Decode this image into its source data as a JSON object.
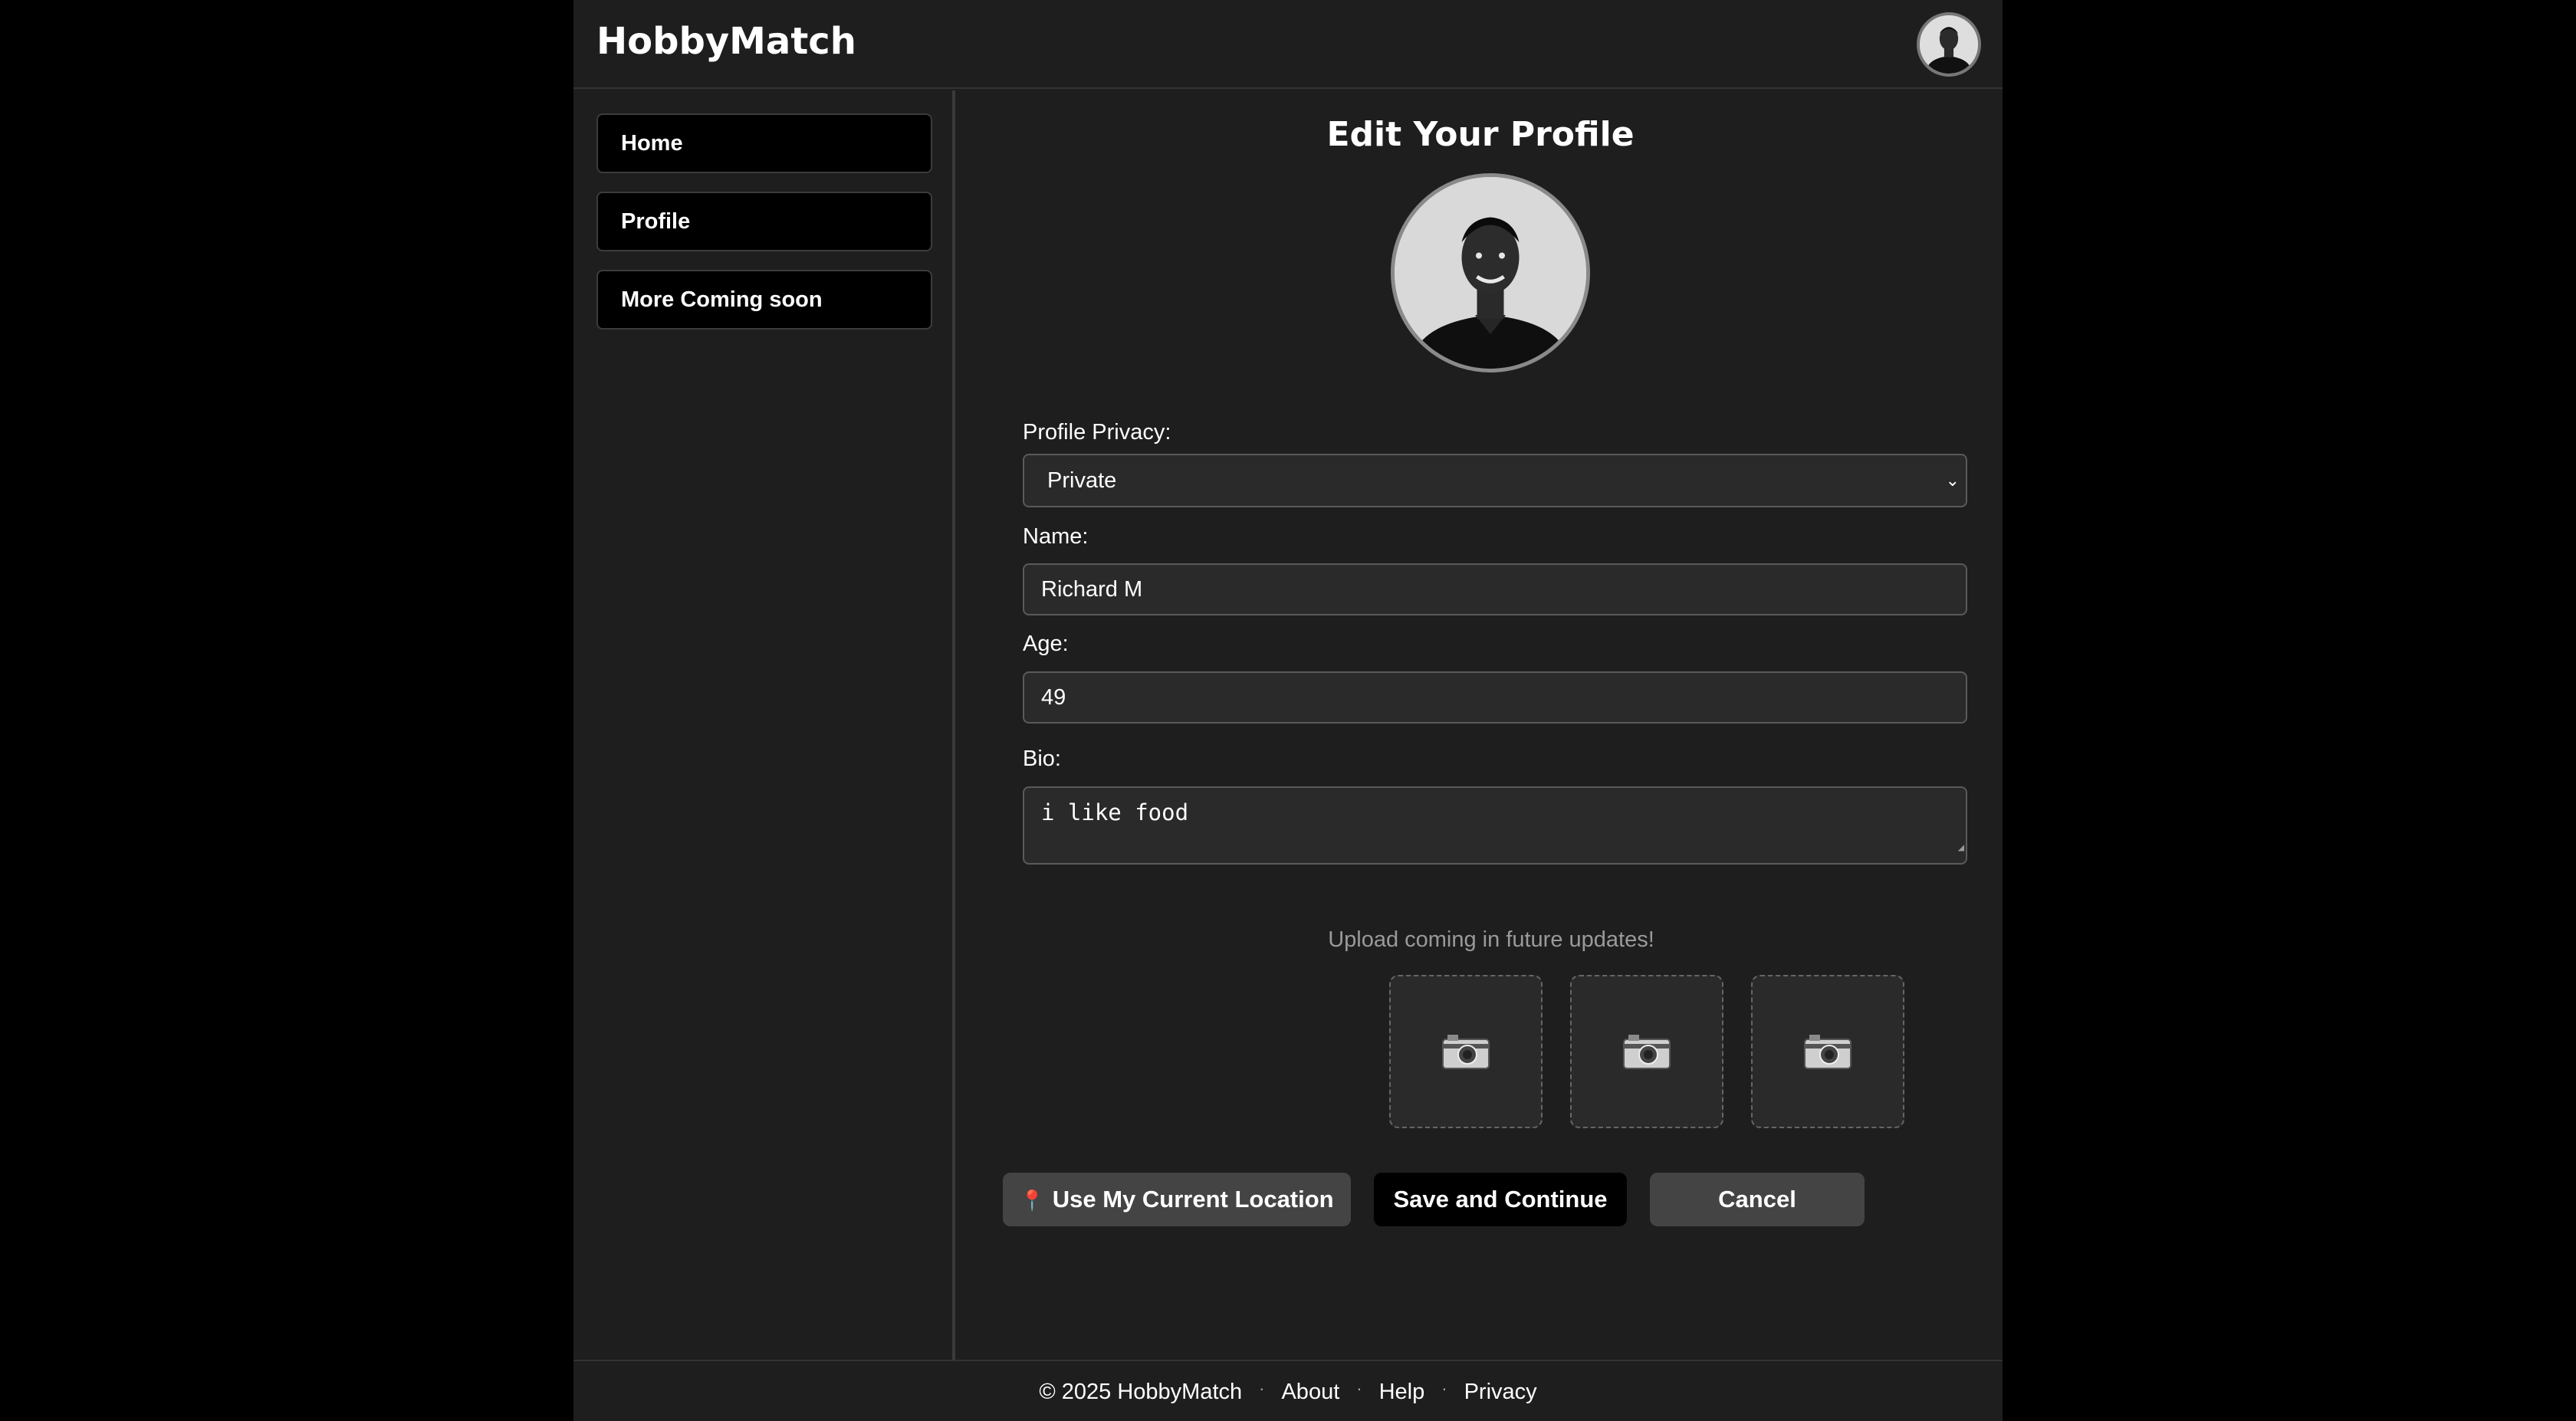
{
  "app": {
    "brand": "HobbyMatch"
  },
  "sidebar": {
    "items": [
      {
        "label": "Home"
      },
      {
        "label": "Profile"
      },
      {
        "label": "More Coming soon"
      }
    ]
  },
  "main": {
    "title": "Edit Your Profile",
    "privacy": {
      "label": "Profile Privacy:",
      "value": "Private"
    },
    "name": {
      "label": "Name:",
      "value": "Richard M"
    },
    "age": {
      "label": "Age:",
      "value": "49"
    },
    "bio": {
      "label": "Bio:",
      "value": "i like food"
    },
    "upload_note": "Upload coming in future updates!",
    "upload_slots": [
      "camera-icon",
      "camera-icon",
      "camera-icon"
    ],
    "buttons": {
      "location": "Use My Current Location",
      "save": "Save and Continue",
      "cancel": "Cancel"
    }
  },
  "footer": {
    "copyright": "© 2025 HobbyMatch",
    "links": [
      "About",
      "Help",
      "Privacy"
    ]
  },
  "colors": {
    "page_bg": "#000000",
    "panel_bg": "#1e1e1e",
    "field_bg": "#2a2a2a",
    "secondary_button": "#444444",
    "primary_button": "#000000",
    "muted_text": "#9a9a9a"
  }
}
